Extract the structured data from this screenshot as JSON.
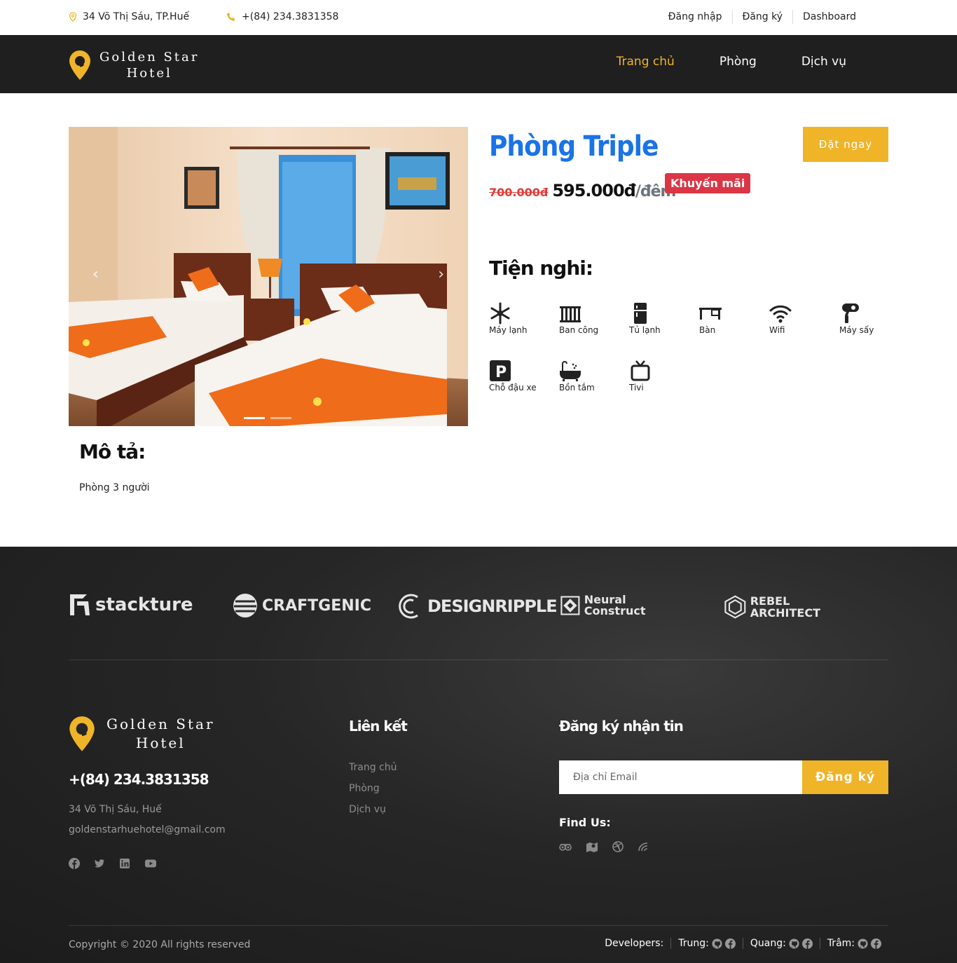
{
  "topbar": {
    "address": "34 Võ Thị Sáu, TP.Huế",
    "phone": "+(84) 234.3831358",
    "login": "Đăng nhập",
    "register": "Đăng ký",
    "dashboard": "Dashboard"
  },
  "brand": {
    "line1": "Golden Star",
    "line2": "Hotel"
  },
  "menu": {
    "home": "Trang chủ",
    "rooms": "Phòng",
    "services": "Dịch vụ"
  },
  "room": {
    "title": "Phòng Triple",
    "book_label": "Đặt ngay",
    "old_price": "700.000đ",
    "price": "595.000đ",
    "unit": "/đêm",
    "promo": "Khuyến mãi",
    "amenities_heading": "Tiện nghi:",
    "amenities": [
      {
        "label": "Máy lạnh",
        "icon": "snowflake-icon"
      },
      {
        "label": "Ban công",
        "icon": "balcony-icon"
      },
      {
        "label": "Tủ lạnh",
        "icon": "fridge-icon"
      },
      {
        "label": "Bàn",
        "icon": "desk-icon"
      },
      {
        "label": "Wifi",
        "icon": "wifi-icon"
      },
      {
        "label": "Máy sấy",
        "icon": "hair-dryer-icon"
      },
      {
        "label": "Chỗ đậu xe",
        "icon": "parking-icon"
      },
      {
        "label": "Bồn tắm",
        "icon": "bathtub-icon"
      },
      {
        "label": "Tivi",
        "icon": "tv-icon"
      }
    ],
    "description_heading": "Mô tả:",
    "description": "Phòng 3 người"
  },
  "partners": [
    "stackture",
    "CRAFTGENIC",
    "DESIGNRIPPLE",
    "Neural Construct",
    "REBEL ARCHITECT"
  ],
  "footer": {
    "phone": "+(84) 234.3831358",
    "address": "34 Võ Thị Sáu, Huế",
    "email": "goldenstarhuehotel@gmail.com",
    "links_heading": "Liên kết",
    "links": [
      "Trang chủ",
      "Phòng",
      "Dịch vụ"
    ],
    "newsletter_heading": "Đăng ký nhận tin",
    "email_placeholder": "Địa chỉ Email",
    "subscribe": "Đăng ký",
    "find_us": "Find Us:",
    "copyright": "Copyright © 2020 All rights reserved",
    "developers_label": "Developers:",
    "developers": [
      "Trung:",
      "Quang:",
      "Trâm:"
    ]
  },
  "colors": {
    "accent": "#f0b429",
    "title_blue": "#1a73e8",
    "promo_red": "#dc3545",
    "dark": "#1f1f1f"
  }
}
